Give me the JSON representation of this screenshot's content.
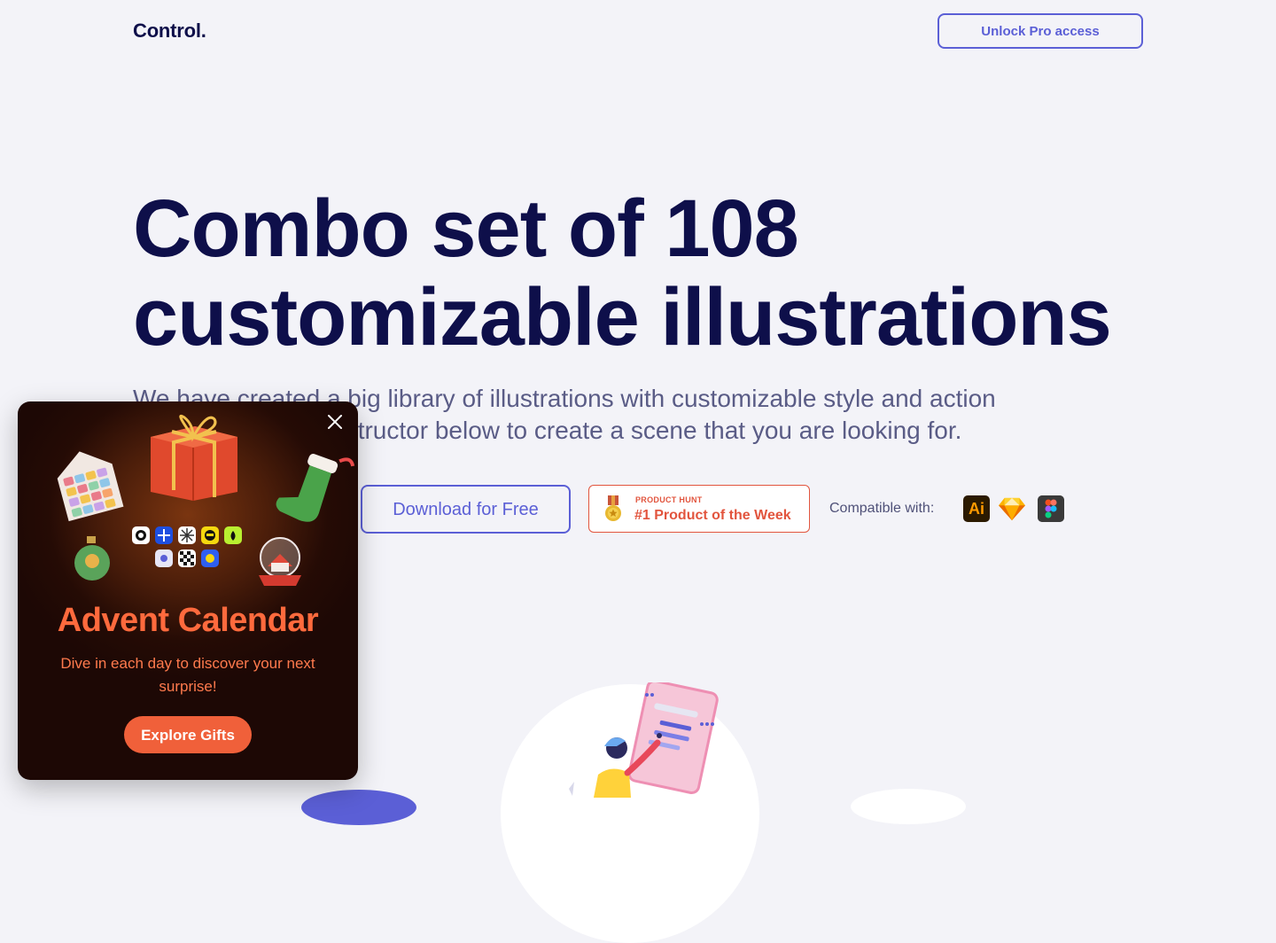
{
  "header": {
    "logo": "Control.",
    "unlock_label": "Unlock Pro access"
  },
  "hero": {
    "title_line1": "Combo set of 108",
    "title_line2": "customizable illustrations",
    "subtitle_line1": "We have created a big library of illustrations with customizable style and action",
    "subtitle_line2": "poses. Use the constructor below to create a scene that you are looking for."
  },
  "cta": {
    "download_label": "Download for Free",
    "product_hunt_small": "PRODUCT HUNT",
    "product_hunt_big": "#1 Product of the Week",
    "compatible_label": "Compatible with:",
    "tools": [
      "Ai",
      "sketch-icon",
      "figma-icon"
    ]
  },
  "popup": {
    "title": "Advent Calendar",
    "description": "Dive in each day to discover your next surprise!",
    "button_label": "Explore Gifts",
    "close_icon": "close-icon"
  },
  "colors": {
    "accent": "#5b5fd6",
    "heading": "#0e0f4a",
    "product_hunt": "#e2553e",
    "popup_title": "#ff6a3d",
    "popup_button": "#f0603a"
  }
}
